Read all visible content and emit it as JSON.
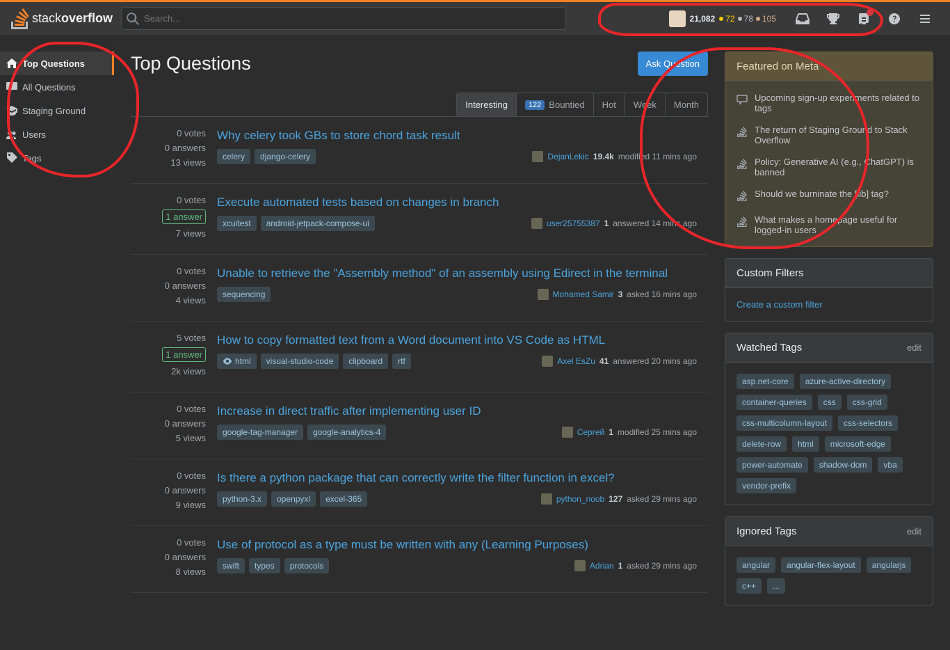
{
  "header": {
    "logo_text_1": "stack",
    "logo_text_2": "overflow",
    "search_placeholder": "Search...",
    "user": {
      "reputation": "21,082",
      "gold": "72",
      "silver": "78",
      "bronze": "105"
    }
  },
  "sidebar": {
    "items": [
      {
        "label": "Top Questions",
        "active": true,
        "icon": "home"
      },
      {
        "label": "All Questions",
        "active": false,
        "icon": "chat"
      },
      {
        "label": "Staging Ground",
        "active": false,
        "icon": "grad"
      },
      {
        "label": "Users",
        "active": false,
        "icon": "users"
      },
      {
        "label": "Tags",
        "active": false,
        "icon": "tag"
      }
    ]
  },
  "main": {
    "title": "Top Questions",
    "ask_button": "Ask Question",
    "tabs": [
      {
        "label": "Interesting",
        "active": true
      },
      {
        "label": "Bountied",
        "badge": "122"
      },
      {
        "label": "Hot"
      },
      {
        "label": "Week"
      },
      {
        "label": "Month"
      }
    ],
    "questions": [
      {
        "votes": "0 votes",
        "answers": "0 answers",
        "answered": false,
        "views": "13 views",
        "title": "Why celery took GBs to store chord task result",
        "tags": [
          "celery",
          "django-celery"
        ],
        "user": "DejanLekic",
        "rep": "19.4k",
        "action": "modified 11 mins ago"
      },
      {
        "votes": "0 votes",
        "answers": "1 answer",
        "answered": true,
        "views": "7 views",
        "title": "Execute automated tests based on changes in branch",
        "tags": [
          "xcuitest",
          "android-jetpack-compose-ui"
        ],
        "user": "user25755387",
        "rep": "1",
        "action": "answered 14 mins ago"
      },
      {
        "votes": "0 votes",
        "answers": "0 answers",
        "answered": false,
        "views": "4 views",
        "title": "Unable to retrieve the \"Assembly method\" of an assembly using Edirect in the terminal",
        "tags": [
          "sequencing"
        ],
        "user": "Mohamed Samir",
        "rep": "3",
        "action": "asked 16 mins ago"
      },
      {
        "votes": "5 votes",
        "answers": "1 answer",
        "answered": true,
        "views": "2k views",
        "title": "How to copy formatted text from a Word document into VS Code as HTML",
        "tags": [
          "html",
          "visual-studio-code",
          "clipboard",
          "rtf"
        ],
        "watched_first": true,
        "user": "Axel EsZu",
        "rep": "41",
        "action": "answered 20 mins ago"
      },
      {
        "votes": "0 votes",
        "answers": "0 answers",
        "answered": false,
        "views": "5 views",
        "title": "Increase in direct traffic after implementing user ID",
        "tags": [
          "google-tag-manager",
          "google-analytics-4"
        ],
        "user": "Сергей",
        "rep": "1",
        "action": "modified 25 mins ago"
      },
      {
        "votes": "0 votes",
        "answers": "0 answers",
        "answered": false,
        "views": "9 views",
        "title": "Is there a python package that can correctly write the filter function in excel?",
        "tags": [
          "python-3.x",
          "openpyxl",
          "excel-365"
        ],
        "user": "python_noob",
        "rep": "127",
        "action": "asked 29 mins ago"
      },
      {
        "votes": "0 votes",
        "answers": "0 answers",
        "answered": false,
        "views": "8 views",
        "title": "Use of protocol as a type must be written with any (Learning Purposes)",
        "tags": [
          "swift",
          "types",
          "protocols"
        ],
        "user": "Adrian",
        "rep": "1",
        "action": "asked 29 mins ago"
      }
    ]
  },
  "right": {
    "meta_header": "Featured on Meta",
    "meta_items": [
      {
        "text": "Upcoming sign-up experiments related to tags",
        "icon": "chat"
      },
      {
        "text": "The return of Staging Ground to Stack Overflow",
        "icon": "so"
      },
      {
        "text": "Policy: Generative AI (e.g., ChatGPT) is banned",
        "icon": "so"
      },
      {
        "text": "Should we burninate the [lib] tag?",
        "icon": "so"
      },
      {
        "text": "What makes a homepage useful for logged-in users",
        "icon": "so"
      }
    ],
    "custom_filters_header": "Custom Filters",
    "create_filter": "Create a custom filter",
    "watched_header": "Watched Tags",
    "edit": "edit",
    "watched_tags": [
      "asp.net-core",
      "azure-active-directory",
      "container-queries",
      "css",
      "css-grid",
      "css-multicolumn-layout",
      "css-selectors",
      "delete-row",
      "html",
      "microsoft-edge",
      "power-automate",
      "shadow-dom",
      "vba",
      "vendor-prefix"
    ],
    "ignored_header": "Ignored Tags",
    "ignored_tags": [
      "angular",
      "angular-flex-layout",
      "angularjs",
      "c++",
      "..."
    ]
  }
}
